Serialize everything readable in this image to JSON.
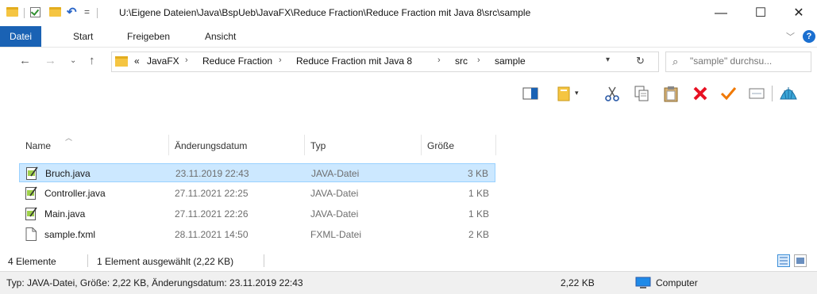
{
  "titlebar": {
    "path": "U:\\Eigene Dateien\\Java\\BspUeb\\JavaFX\\Reduce Fraction\\Reduce Fraction mit Java 8\\src\\sample",
    "qa_dropdown_glyph": "=",
    "minimize": "—",
    "maximize": "☐",
    "close": "✕"
  },
  "ribbon": {
    "tabs": [
      "Datei",
      "Start",
      "Freigeben",
      "Ansicht"
    ],
    "help_glyph": "?"
  },
  "address": {
    "overflow": "«",
    "crumbs": [
      "JavaFX",
      "Reduce Fraction",
      "Reduce Fraction mit Java 8",
      "src",
      "sample"
    ],
    "separator": "›",
    "search_placeholder": "\"sample\" durchsu..."
  },
  "columns": {
    "name": "Name",
    "date": "Änderungsdatum",
    "type": "Typ",
    "size": "Größe"
  },
  "files": [
    {
      "name": "Bruch.java",
      "date": "23.11.2019 22:43",
      "type": "JAVA-Datei",
      "size": "3 KB",
      "icon": "java-file-icon",
      "selected": true
    },
    {
      "name": "Controller.java",
      "date": "27.11.2021 22:25",
      "type": "JAVA-Datei",
      "size": "1 KB",
      "icon": "java-file-icon",
      "selected": false
    },
    {
      "name": "Main.java",
      "date": "27.11.2021 22:26",
      "type": "JAVA-Datei",
      "size": "1 KB",
      "icon": "java-file-icon",
      "selected": false
    },
    {
      "name": "sample.fxml",
      "date": "28.11.2021 14:50",
      "type": "FXML-Datei",
      "size": "2 KB",
      "icon": "blank-file-icon",
      "selected": false
    }
  ],
  "status": {
    "count": "4 Elemente",
    "selection": "1 Element ausgewählt (2,22 KB)",
    "details": "Typ: JAVA-Datei, Größe: 2,22 KB, Änderungsdatum: 23.11.2019 22:43",
    "size": "2,22 KB",
    "location": "Computer"
  },
  "colors": {
    "accent": "#1a62b4",
    "selection_bg": "#cce8ff",
    "selection_border": "#99d1ff",
    "delete_red": "#e81123",
    "check_orange": "#f07800"
  }
}
